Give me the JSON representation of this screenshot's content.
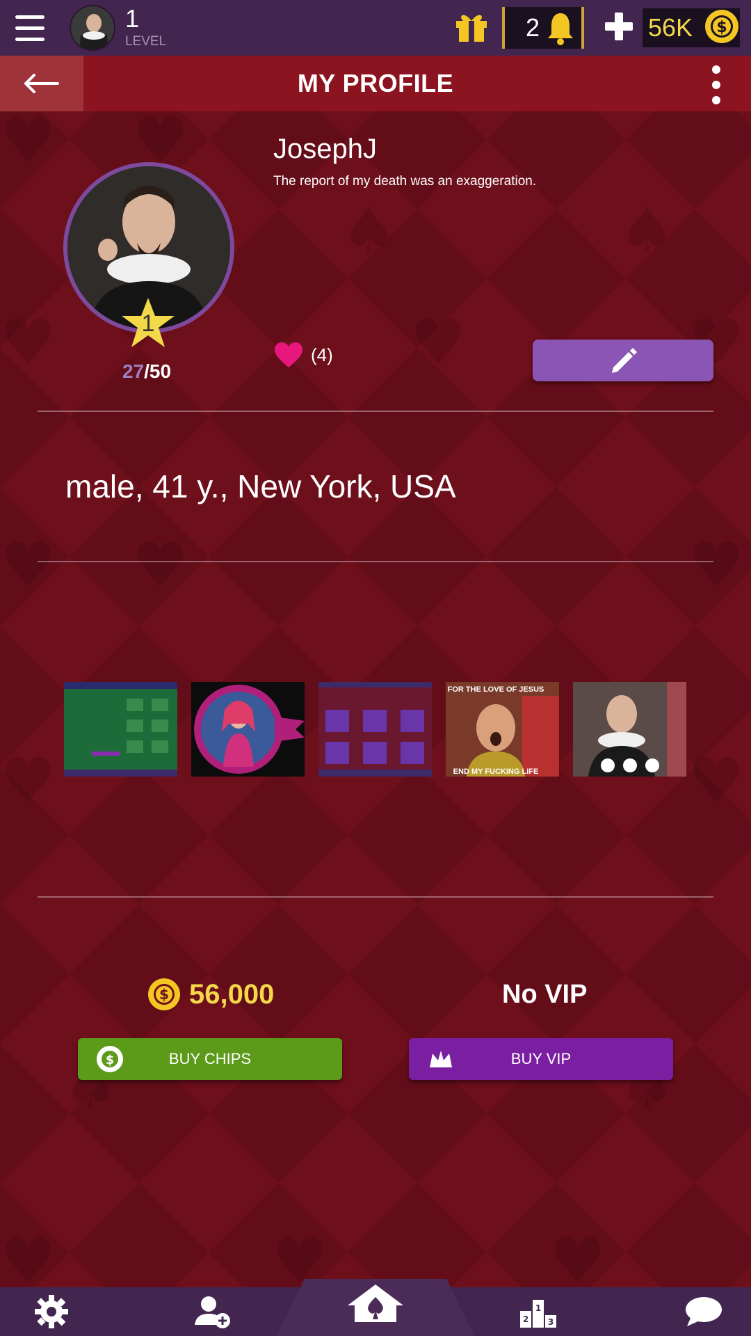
{
  "topbar": {
    "level_number": "1",
    "level_label": "LEVEL",
    "notification_count": "2",
    "chips_short": "56K"
  },
  "header": {
    "title": "MY PROFILE"
  },
  "profile": {
    "username": "JosephJ",
    "status": "The report of my death was an exaggeration.",
    "level_badge": "1",
    "xp_current": "27",
    "xp_total": "/50",
    "likes": "(4)",
    "bio": "male, 41 y., New York, USA"
  },
  "photos": [
    {
      "name": "photo-1"
    },
    {
      "name": "photo-2"
    },
    {
      "name": "photo-3"
    },
    {
      "name": "photo-4",
      "top_text": "FOR THE LOVE OF JESUS",
      "bottom_text": "END MY FUCKING LIFE"
    },
    {
      "name": "photo-5"
    }
  ],
  "balance": {
    "chips": "56,000",
    "vip": "No VIP",
    "buy_chips_label": "BUY CHIPS",
    "buy_vip_label": "BUY VIP"
  },
  "colors": {
    "topbar": "#43264f",
    "header": "#8b1420",
    "background": "#6e0f1c",
    "gold": "#f3d94a",
    "purple": "#8a55b4",
    "green": "#5c9a1a",
    "vip_purple": "#7b1fa2",
    "heart": "#e8177d"
  },
  "icons": [
    "menu-icon",
    "gift-icon",
    "bell-icon",
    "plus-icon",
    "chip-coin-icon",
    "back-arrow-icon",
    "more-vertical-icon",
    "star-icon",
    "heart-icon",
    "pencil-icon",
    "crown-icon",
    "gear-icon",
    "add-friend-icon",
    "home-spade-icon",
    "leaderboard-icon",
    "chat-icon"
  ]
}
